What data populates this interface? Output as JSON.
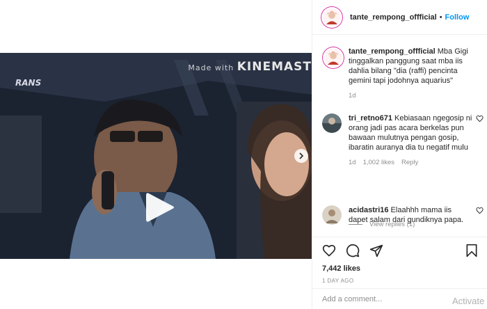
{
  "header": {
    "username": "tante_rempong_offficial",
    "separator": "•",
    "follow_label": "Follow"
  },
  "video": {
    "watermark_small": "Made with",
    "watermark_big": "KINEMAST",
    "channel_logo": "RANS"
  },
  "caption": {
    "username": "tante_rempong_offficial",
    "text": "Mba Gigi tinggalkan panggung saat mba iis dahlia bilang \"dia (raffi) pencinta gemini tapi jodohnya aquarius\"",
    "time": "1d"
  },
  "comments": [
    {
      "username": "tri_retno671",
      "text": "Kebiasaan ngegosip ni orang jadi pas acara berkelas pun bawaan mulutnya pengan gosip, ibaratin auranya dia tu negatif mulu",
      "time": "1d",
      "likes": "1,002 likes",
      "reply_label": "Reply",
      "view_replies": "View replies (1)"
    },
    {
      "username": "acidastri16",
      "text": "Elaahhh mama iis dapet salam dari gundiknya papa."
    }
  ],
  "post": {
    "likes": "7,442 likes",
    "posted_ago": "1 DAY AGO",
    "add_comment_placeholder": "Add a comment..."
  },
  "overlay": {
    "activate_text": "Activate"
  },
  "icons": [
    "play-icon",
    "chevron-right-icon",
    "heart-icon",
    "comment-icon",
    "share-icon",
    "bookmark-icon"
  ],
  "colors": {
    "link_blue": "#0095f6",
    "secondary_text": "#8e8e8e",
    "border": "#efefef"
  }
}
